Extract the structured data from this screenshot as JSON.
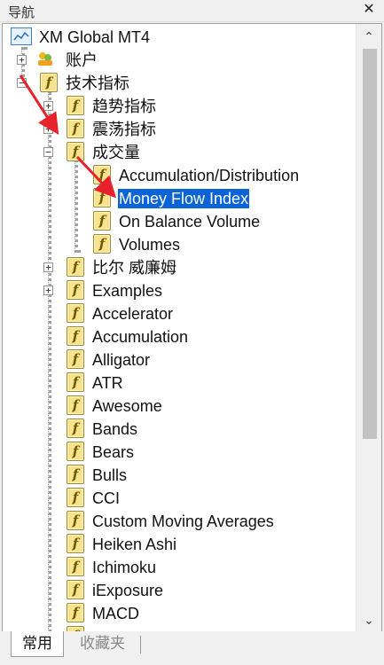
{
  "window": {
    "title": "导航",
    "close_icon": "close-icon"
  },
  "tree": {
    "root": "XM Global MT4",
    "accounts": "账户",
    "indicators": "技术指标",
    "trend": "趋势指标",
    "oscillators": "震荡指标",
    "volumes_folder": "成交量",
    "vol_items": [
      "Accumulation/Distribution",
      "Money Flow Index",
      "On Balance Volume",
      "Volumes"
    ],
    "bill_williams": "比尔 威廉姆",
    "examples": "Examples",
    "custom": [
      "Accelerator",
      "Accumulation",
      "Alligator",
      "ATR",
      "Awesome",
      "Bands",
      "Bears",
      "Bulls",
      "CCI",
      "Custom Moving Averages",
      "Heiken Ashi",
      "Ichimoku",
      "iExposure",
      "MACD"
    ]
  },
  "tabs": {
    "common": "常用",
    "favorites": "收藏夹"
  },
  "colors": {
    "selection": "#0a64d6",
    "arrow": "#e8222a",
    "icon_fill": "#f7e28d"
  }
}
